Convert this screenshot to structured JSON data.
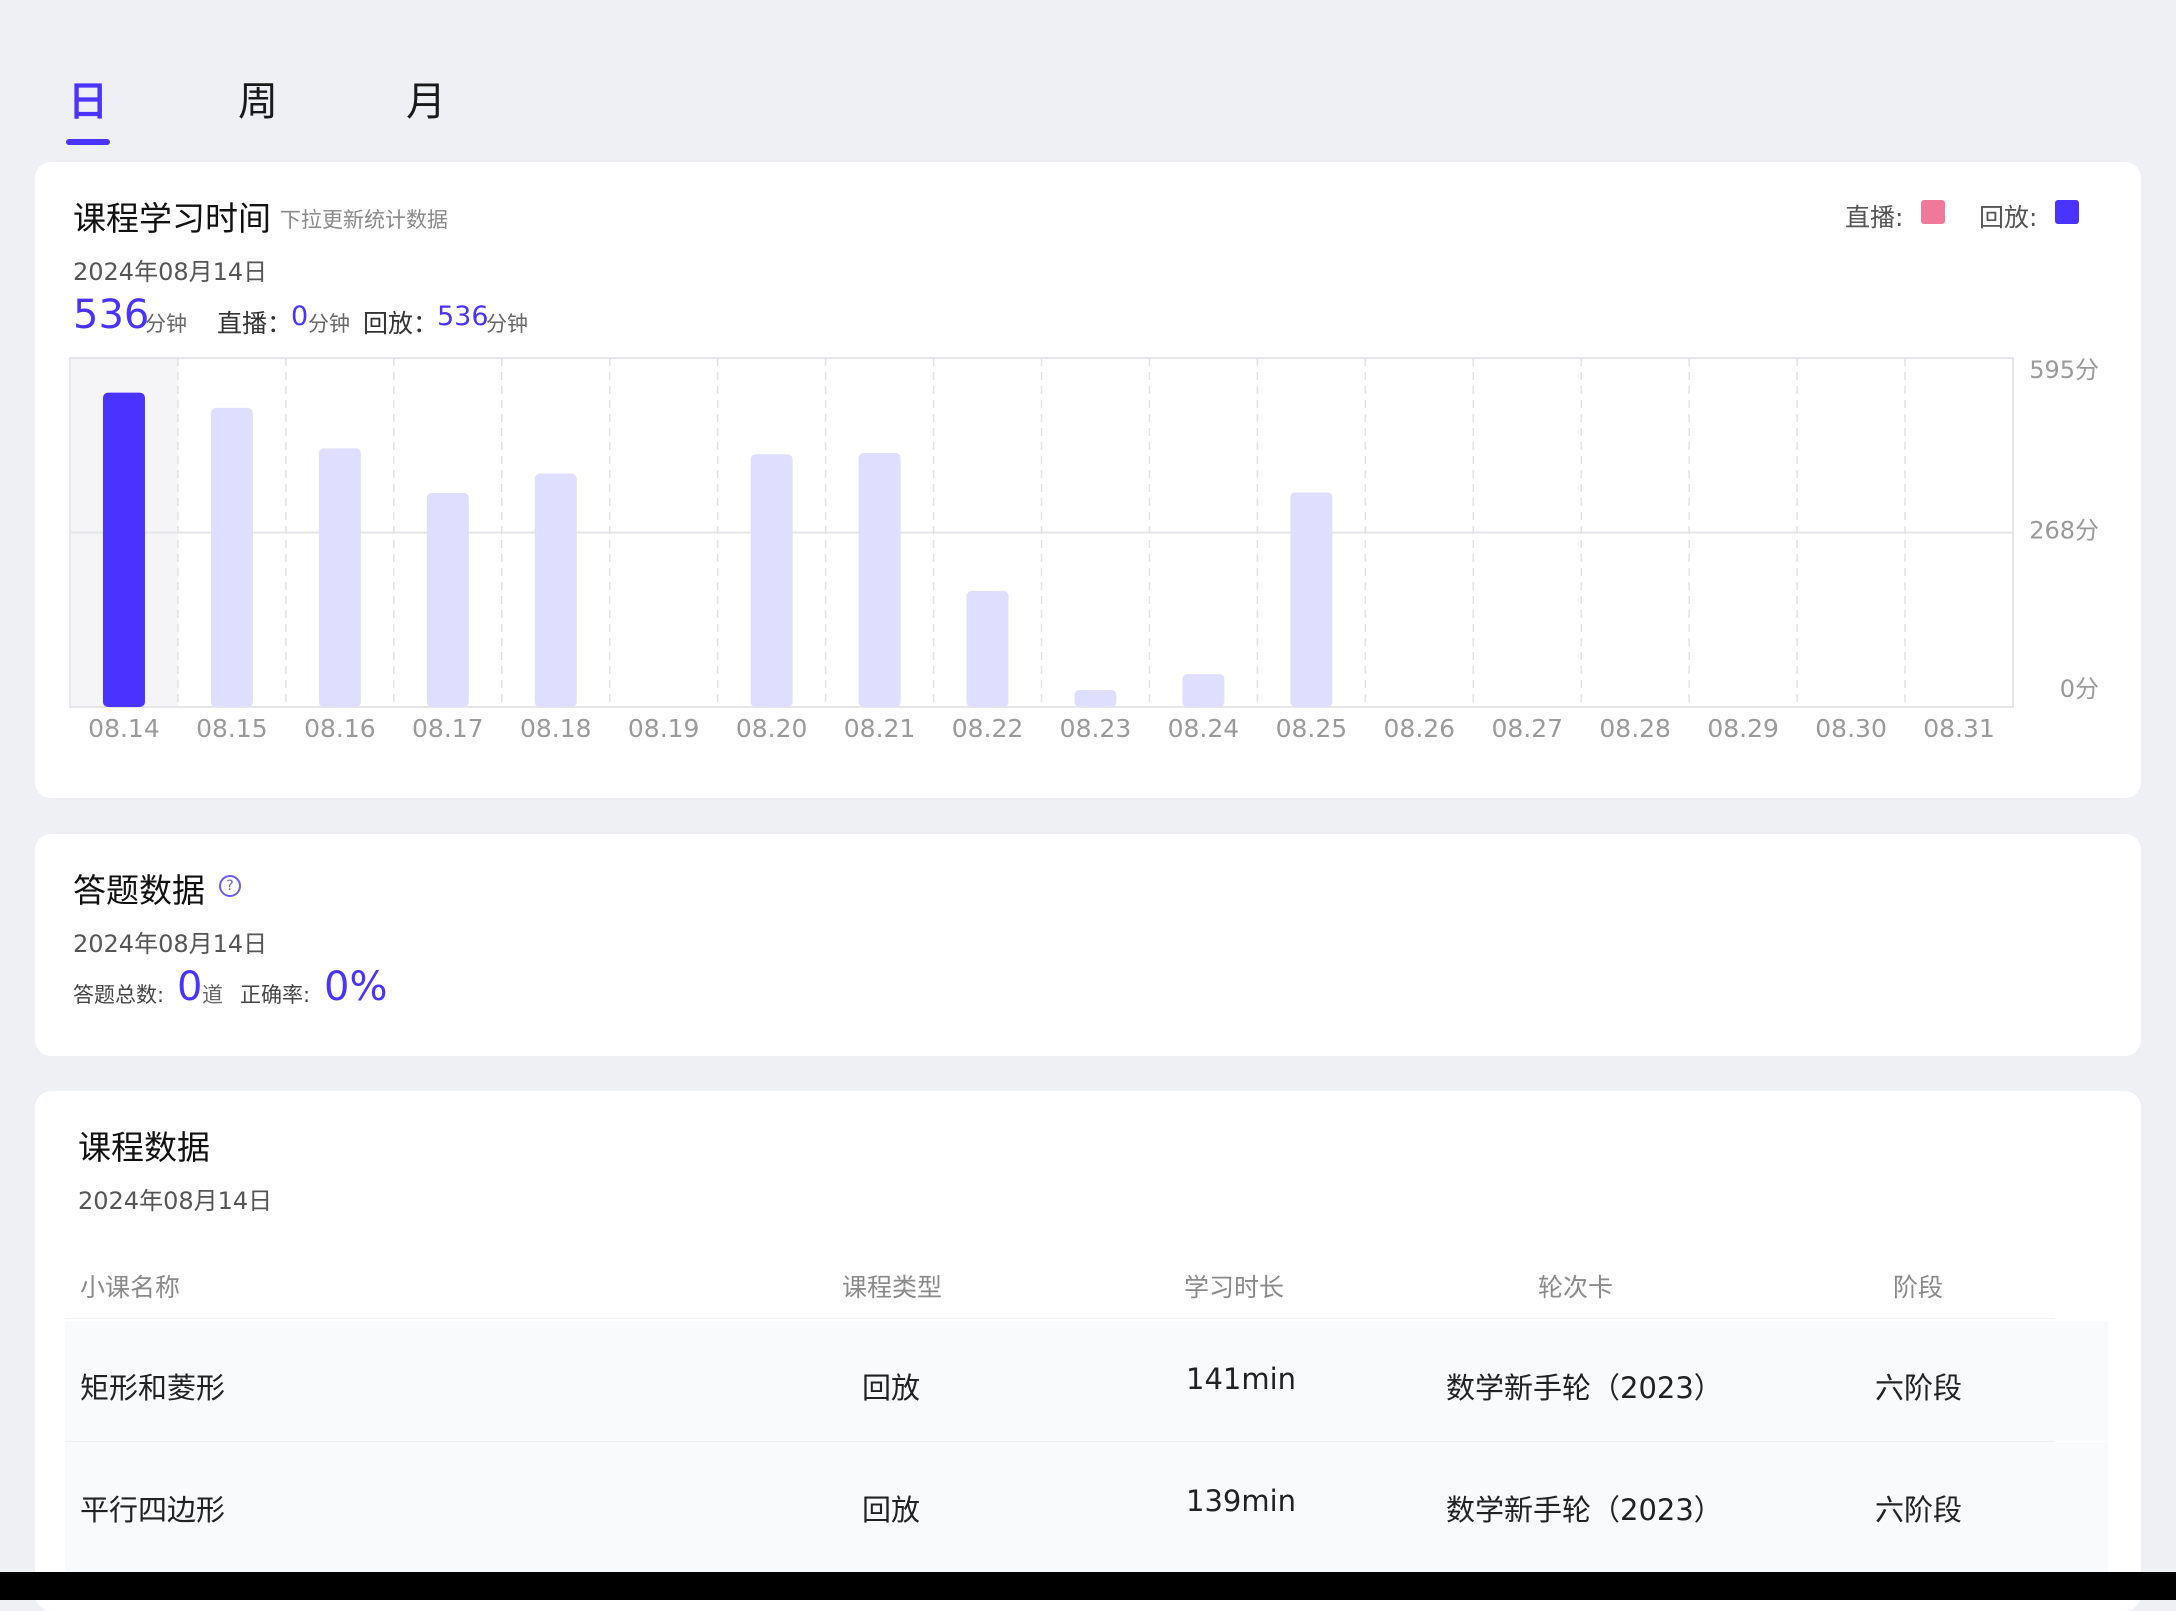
{
  "tabs": {
    "day": "日",
    "week": "周",
    "month": "月"
  },
  "study_time": {
    "title": "课程学习时间",
    "hint": "下拉更新统计数据",
    "date": "2024年08月14日",
    "total": "536",
    "total_unit": "分钟",
    "live_label": "直播：",
    "live_value": "0",
    "live_unit": "分钟",
    "replay_label": "回放：",
    "replay_value": "536",
    "replay_unit": "分钟",
    "legend": {
      "live_label": "直播:",
      "live_color": "#f0789a",
      "replay_label": "回放:",
      "replay_color": "#4b33ff"
    }
  },
  "chart_data": {
    "type": "bar",
    "categories": [
      "08.14",
      "08.15",
      "08.16",
      "08.17",
      "08.18",
      "08.19",
      "08.20",
      "08.21",
      "08.22",
      "08.23",
      "08.24",
      "08.25",
      "08.26",
      "08.27",
      "08.28",
      "08.29",
      "08.30",
      "08.31"
    ],
    "values": [
      536,
      510,
      441,
      365,
      398,
      0,
      431,
      433,
      198,
      29,
      56,
      366,
      0,
      0,
      0,
      0,
      0,
      0
    ],
    "selected_index": 0,
    "selected_color": "#4b33ff",
    "bar_color": "#e0deff",
    "y_ticks": [
      "595分",
      "268分",
      "0分"
    ],
    "ylim": [
      0,
      595
    ],
    "grid": true,
    "title": "",
    "xlabel": "",
    "ylabel": ""
  },
  "quiz": {
    "title": "答题数据",
    "help_icon": "question-circle-icon",
    "date": "2024年08月14日",
    "total_label": "答题总数:",
    "total_value": "0",
    "total_unit": "道",
    "accuracy_label": "正确率:",
    "accuracy_value": "0%"
  },
  "course": {
    "title": "课程数据",
    "date": "2024年08月14日",
    "headers": [
      "小课名称",
      "课程类型",
      "学习时长",
      "轮次卡",
      "阶段"
    ],
    "rows": [
      {
        "name": "矩形和菱形",
        "type": "回放",
        "duration": "141min",
        "round": "数学新手轮（2023）",
        "stage": "六阶段"
      },
      {
        "name": "平行四边形",
        "type": "回放",
        "duration": "139min",
        "round": "数学新手轮（2023）",
        "stage": "六阶段"
      }
    ]
  }
}
